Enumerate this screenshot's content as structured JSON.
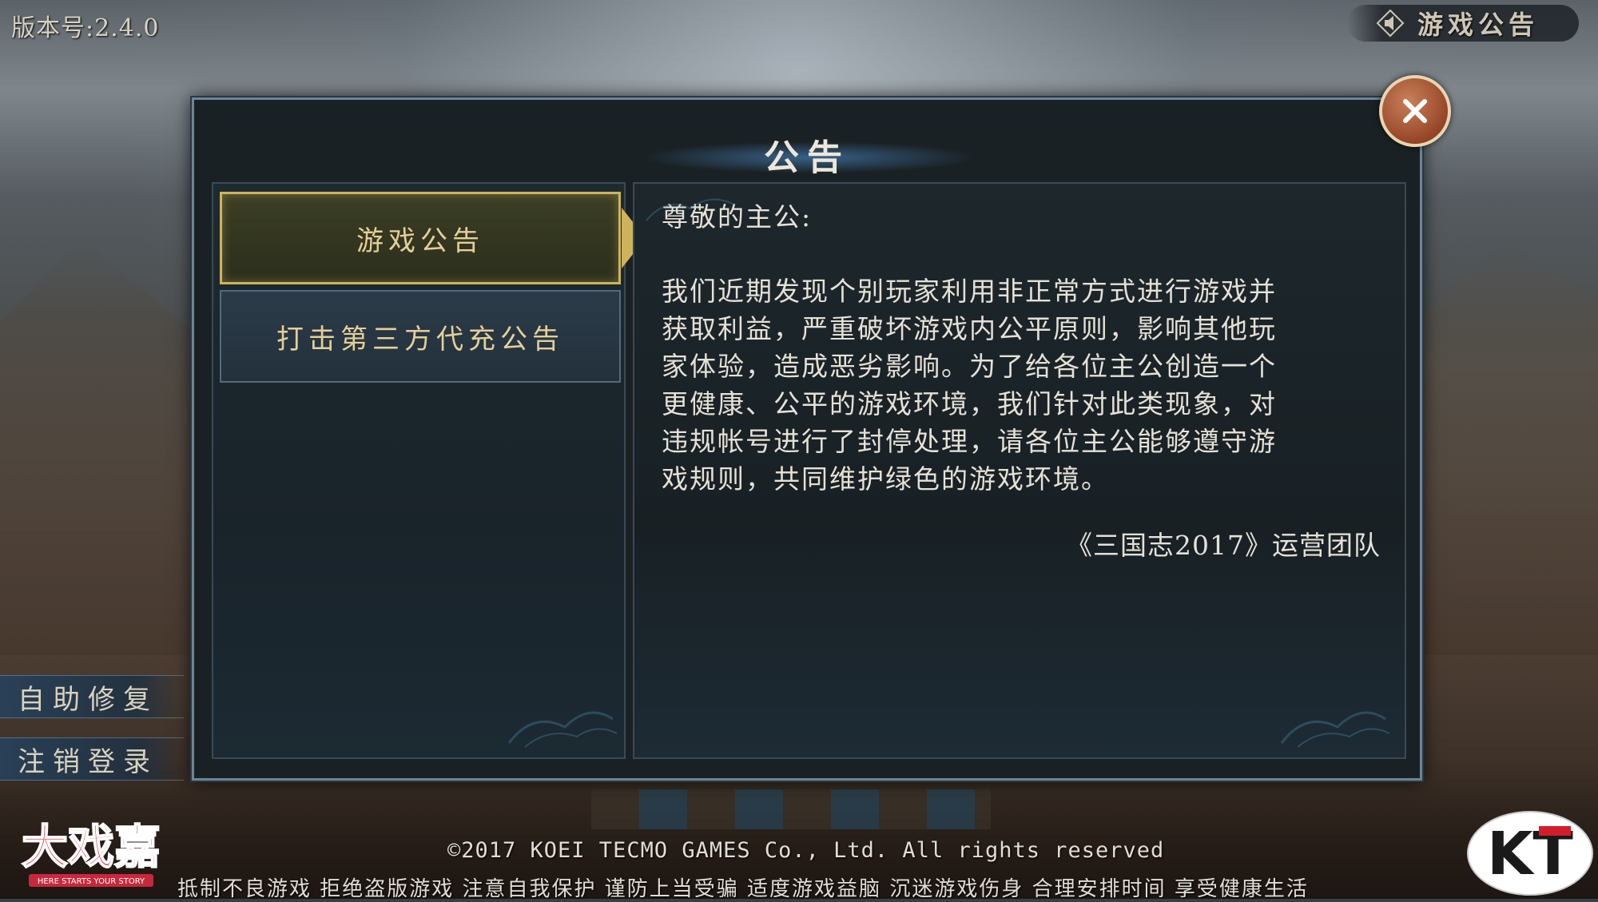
{
  "version": "版本号:2.4.0",
  "top_bar": {
    "notice_label": "游戏公告"
  },
  "side_buttons": {
    "repair": "自助修复",
    "logout": "注销登录"
  },
  "dialog": {
    "title": "公告",
    "tabs": [
      {
        "label": "游戏公告",
        "active": true
      },
      {
        "label": "打击第三方代充公告",
        "active": false
      }
    ],
    "content": {
      "greeting": "尊敬的主公:",
      "lines": [
        "我们近期发现个别玩家利用非正常方式进行游戏并",
        "获取利益，严重破坏游戏内公平原则，影响其他玩",
        "家体验，造成恶劣影响。为了给各位主公创造一个",
        "更健康、公平的游戏环境，我们针对此类现象，对",
        "违规帐号进行了封停处理，请各位主公能够遵守游",
        "戏规则，共同维护绿色的游戏环境。"
      ],
      "signature": "《三国志2017》运营团队"
    }
  },
  "footer": {
    "copyright": "©2017  KOEI TECMO GAMES Co., Ltd. All rights reserved",
    "health_notice": "抵制不良游戏 拒绝盗版游戏 注意自我保护 谨防上当受骗 适度游戏益脑 沉迷游戏伤身 合理安排时间 享受健康生活"
  },
  "logos": {
    "left_text": "大戏嘉",
    "left_tagline": "HERE STARTS YOUR STORY",
    "right_text": "KT"
  },
  "colors": {
    "tab_active_border": "#cdb45c",
    "close_button": "#9a4a2b",
    "dialog_border": "#6d8596"
  }
}
